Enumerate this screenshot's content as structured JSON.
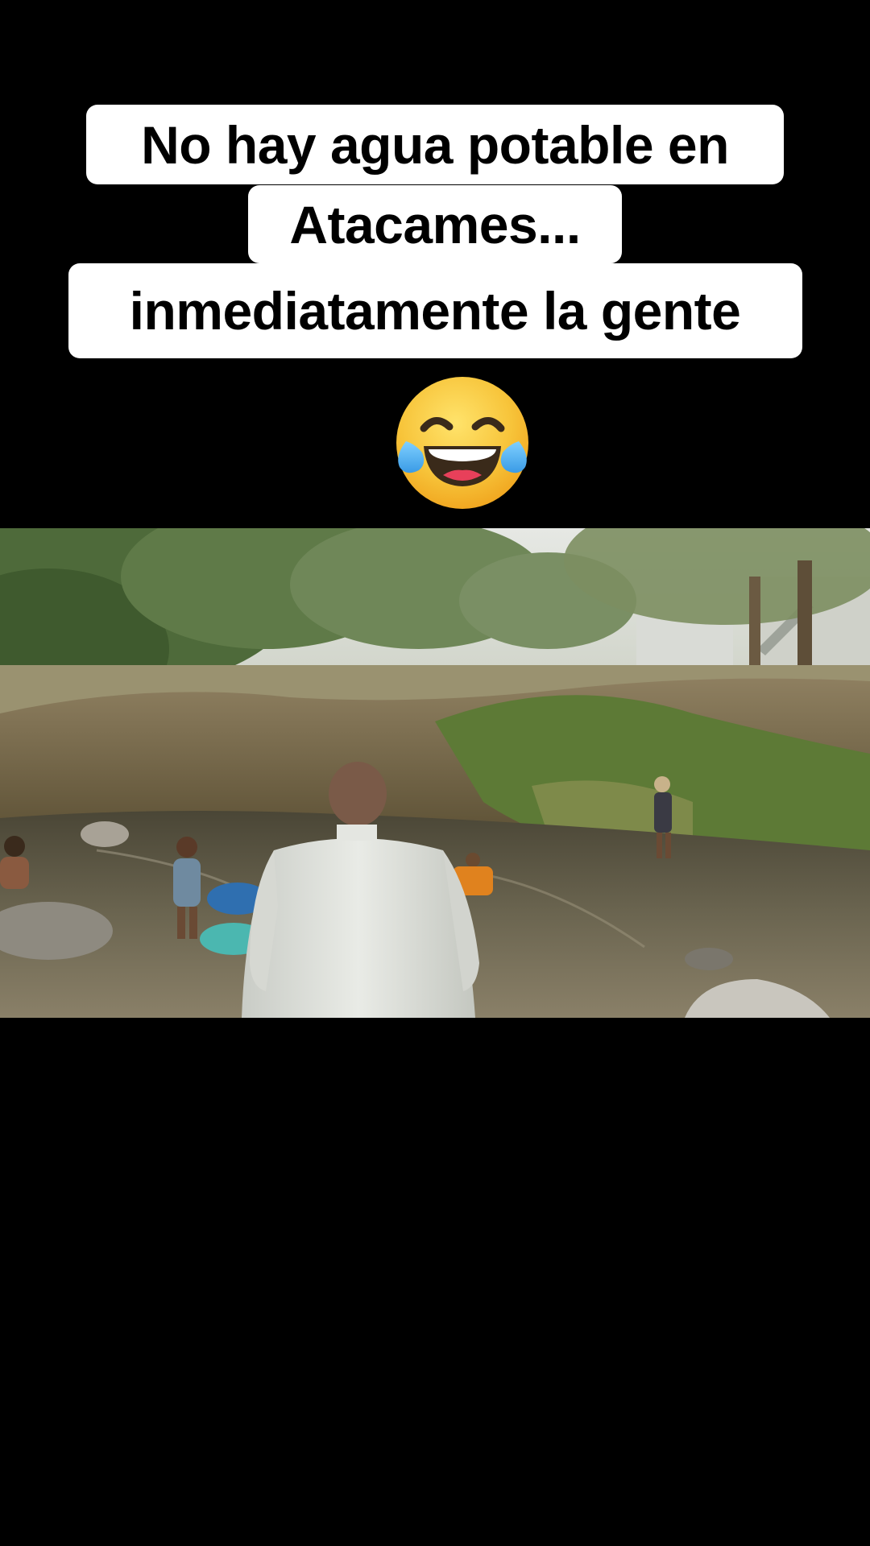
{
  "caption": {
    "line1": "No hay agua potable en",
    "line2": "Atacames...",
    "line3": "inmediatamente la gente"
  },
  "emoji": {
    "icon": "face-with-tears-of-joy-icon"
  },
  "video": {
    "scene": "river-scene-image"
  },
  "colors": {
    "background": "#000000",
    "caption_bg": "#ffffff",
    "caption_text": "#000000",
    "emoji_yellow": "#f7c43a",
    "tears_blue": "#4fb3f0"
  }
}
